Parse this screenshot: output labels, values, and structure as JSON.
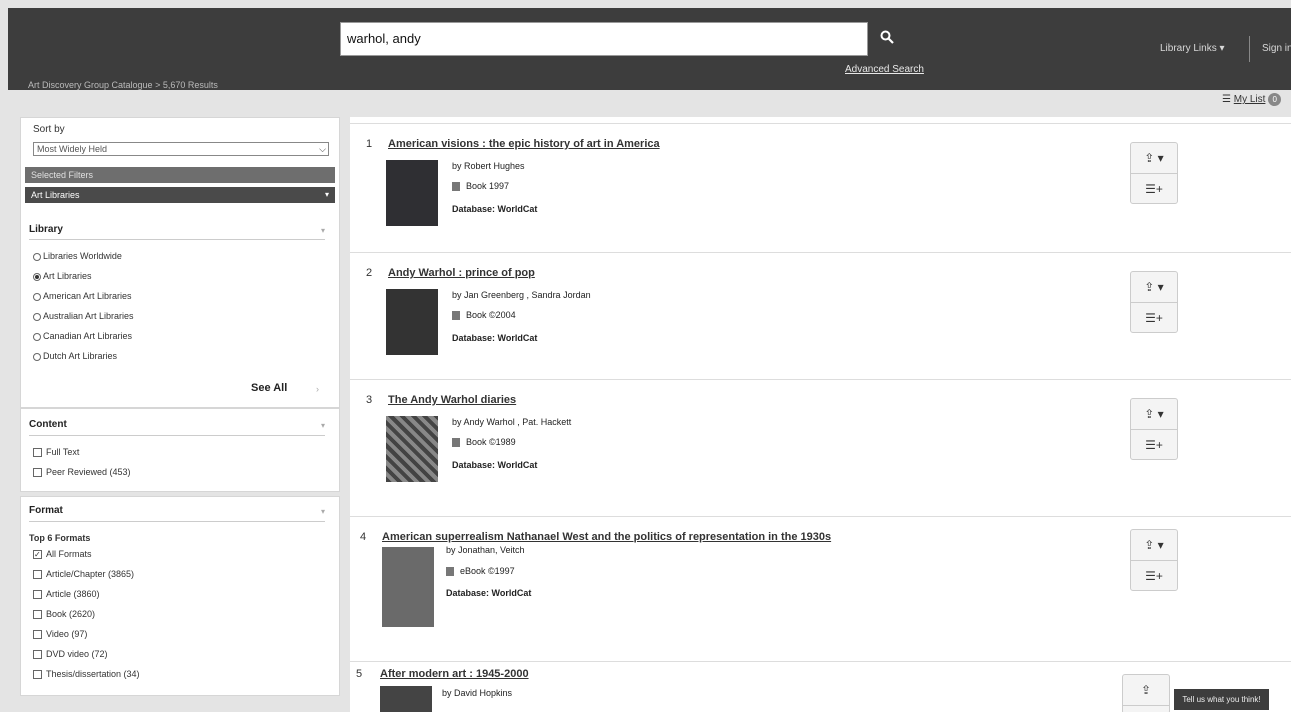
{
  "header": {
    "search_value": "warhol, andy",
    "advanced_search": "Advanced Search",
    "library_links": "Library Links",
    "sign_in": "Sign in",
    "breadcrumb_catalogue": "Art Discovery Group Catalogue",
    "breadcrumb_results": "5,670 Results",
    "my_list": "My List",
    "my_list_count": "0"
  },
  "sidebar": {
    "sort_label": "Sort by",
    "sort_value": "Most Widely Held",
    "selected_filters": "Selected Filters",
    "active_filter": "Art Libraries",
    "library": {
      "heading": "Library",
      "options": [
        {
          "label": "Libraries Worldwide",
          "checked": false
        },
        {
          "label": "Art Libraries",
          "checked": true
        },
        {
          "label": "American Art Libraries",
          "checked": false
        },
        {
          "label": "Australian Art Libraries",
          "checked": false
        },
        {
          "label": "Canadian Art Libraries",
          "checked": false
        },
        {
          "label": "Dutch Art Libraries",
          "checked": false
        }
      ],
      "see_all": "See All"
    },
    "content": {
      "heading": "Content",
      "options": [
        {
          "label": "Full Text",
          "checked": false
        },
        {
          "label": "Peer Reviewed (453)",
          "checked": false
        }
      ]
    },
    "format": {
      "heading": "Format",
      "top_label": "Top 6 Formats",
      "options": [
        {
          "label": "All Formats",
          "checked": true
        },
        {
          "label": "Article/Chapter (3865)",
          "checked": false
        },
        {
          "label": "Article (3860)",
          "checked": false
        },
        {
          "label": "Book (2620)",
          "checked": false
        },
        {
          "label": "Video (97)",
          "checked": false
        },
        {
          "label": "DVD video (72)",
          "checked": false
        },
        {
          "label": "Thesis/dissertation (34)",
          "checked": false
        }
      ]
    }
  },
  "results": [
    {
      "num": "1",
      "title": "American visions : the epic history of art in America",
      "author": "by Robert Hughes",
      "type": "Book 1997",
      "database": "Database: WorldCat"
    },
    {
      "num": "2",
      "title": "Andy Warhol : prince of pop",
      "author": "by Jan Greenberg , Sandra Jordan",
      "type": "Book ©2004",
      "database": "Database: WorldCat"
    },
    {
      "num": "3",
      "title": "The Andy Warhol diaries",
      "author": "by Andy Warhol , Pat. Hackett",
      "type": "Book ©1989",
      "database": "Database: WorldCat"
    },
    {
      "num": "4",
      "title": "American superrealism Nathanael West and the politics of representation in the 1930s",
      "author": "by Jonathan, Veitch",
      "type": "eBook ©1997",
      "database": "Database: WorldCat"
    },
    {
      "num": "5",
      "title": "After modern art : 1945-2000",
      "author": "by David Hopkins",
      "type": "",
      "database": ""
    }
  ],
  "feedback": "Tell us what you think!",
  "icons": {
    "search": "search-icon",
    "share": "share-icon",
    "add_to_list": "add-to-list-icon",
    "book": "book-icon"
  }
}
